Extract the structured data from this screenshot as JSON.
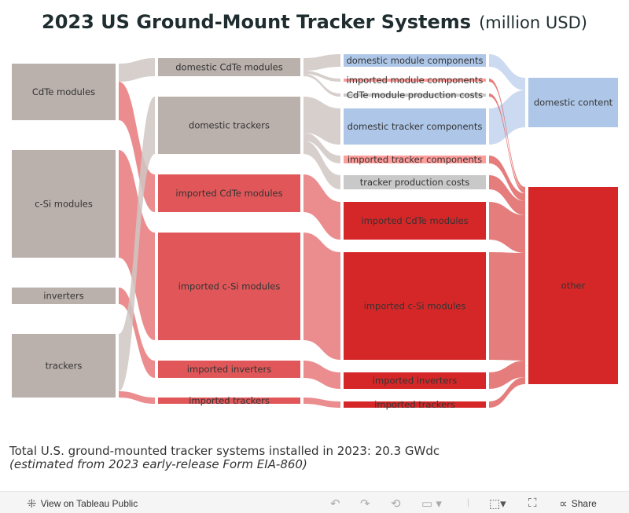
{
  "title": {
    "main": "2023 US Ground-Mount Tracker Systems",
    "unit": "(million USD)"
  },
  "colors": {
    "gray_node": "#bab0ac",
    "gray_link": "#cfc7c3",
    "red_node2": "#e15759",
    "red_link": "#e8797b",
    "blue": "#aec7e8",
    "pink": "#ff9d9a",
    "light_gray": "#c9c9c9",
    "red": "#d62728",
    "blue_link": "#c2d4ee",
    "red_link_out": "#e06666"
  },
  "columns": [
    [
      "CdTe modules",
      "c-Si modules",
      "inverters",
      "trackers"
    ],
    [
      "domestic CdTe modules",
      "domestic trackers",
      "imported CdTe modules",
      "imported c-Si modules",
      "imported inverters",
      "imported trackers"
    ],
    [
      "domestic module components",
      "imported module components",
      "CdTe module production costs",
      "domestic tracker components",
      "imported tracker components",
      "tracker production costs",
      "imported CdTe modules",
      "imported c-Si modules",
      "imported inverters",
      "imported trackers"
    ],
    [
      "domestic content",
      "other"
    ]
  ],
  "footnote": {
    "line1": "Total U.S. ground-mounted tracker systems installed in 2023: 20.3 GWdc",
    "line2": "(estimated from 2023 early-release Form EIA-860)"
  },
  "toolbar": {
    "view": "View on Tableau Public",
    "share": "Share",
    "icons": [
      "tableau-logo-icon",
      "undo-icon",
      "redo-icon",
      "revert-icon",
      "refresh-icon",
      "download-icon",
      "fullscreen-icon",
      "share-icon"
    ]
  }
}
